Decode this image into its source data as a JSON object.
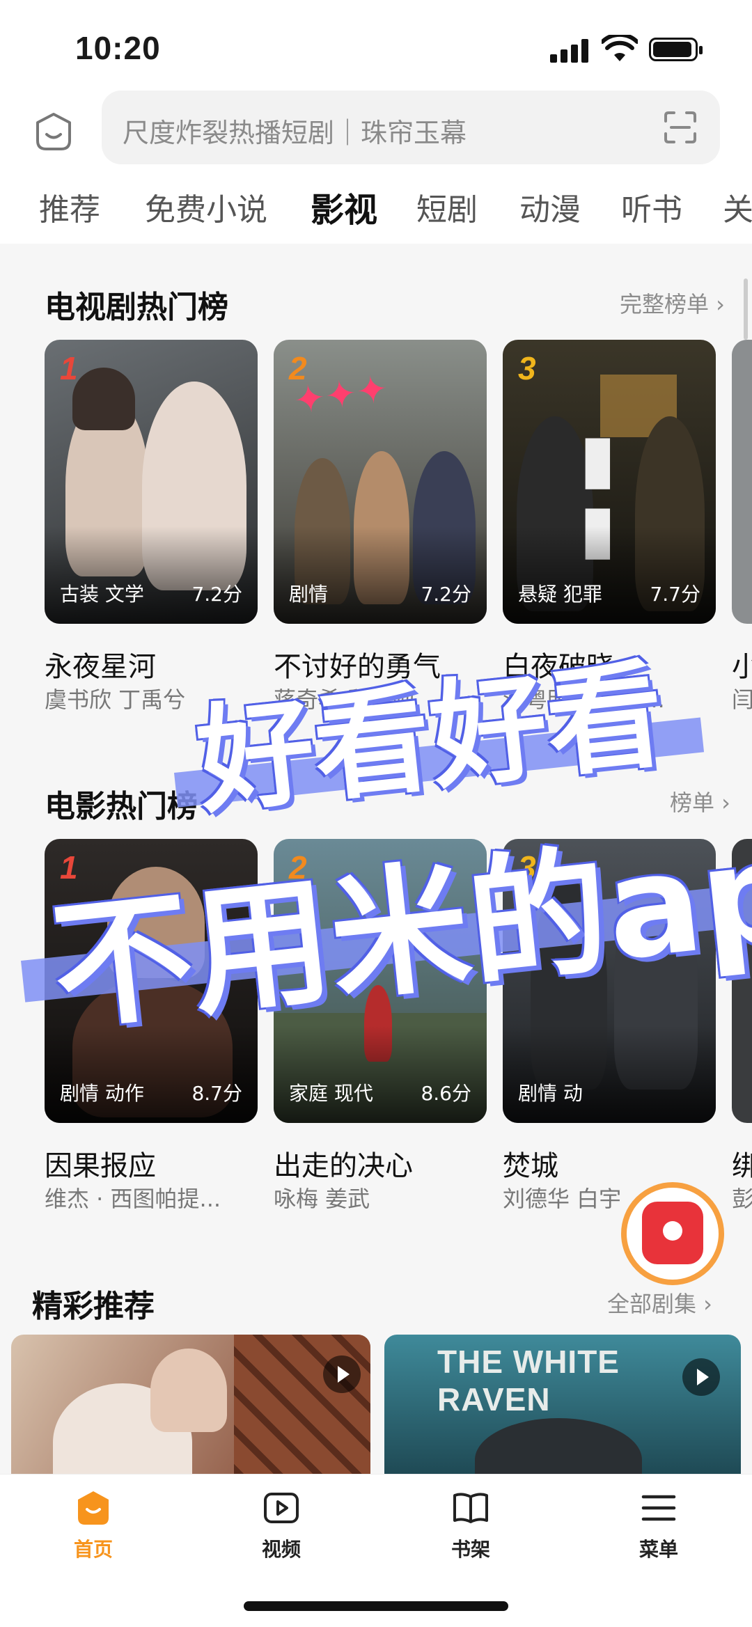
{
  "status": {
    "time": "10:20"
  },
  "search": {
    "placeholder": "尺度炸裂热播短剧｜珠帘玉幕"
  },
  "tabs": [
    "推荐",
    "免费小说",
    "影视",
    "短剧",
    "动漫",
    "听书",
    "关"
  ],
  "active_tab": "影视",
  "tv": {
    "title": "电视剧热门榜",
    "link": "完整榜单 ›",
    "items": [
      {
        "rank": "1",
        "tags": "古装 文学",
        "score": "7.2分",
        "title": "永夜星河",
        "cast": "虞书欣 丁禹兮"
      },
      {
        "rank": "2",
        "tags": "剧情",
        "score": "7.2分",
        "title": "不讨好的勇气",
        "cast": "蒋奇希 魏大勋"
      },
      {
        "rank": "3",
        "tags": "悬疑 犯罪",
        "score": "7.7分",
        "title": "白夜破晓",
        "cast": "潘粤明  王龙正..."
      },
      {
        "rank": "",
        "tags": "",
        "score": "",
        "title": "小",
        "cast": "闫"
      }
    ]
  },
  "movie": {
    "title": "电影热门榜",
    "link": "榜单 ›",
    "items": [
      {
        "rank": "1",
        "tags": "剧情 动作",
        "score": "8.7分",
        "title": "因果报应",
        "cast": "维杰 · 西图帕提..."
      },
      {
        "rank": "2",
        "tags": "家庭 现代",
        "score": "8.6分",
        "title": "出走的决心",
        "cast": "咏梅 姜武"
      },
      {
        "rank": "3",
        "tags": "剧情 动",
        "score": "",
        "title": "焚城",
        "cast": "刘德华 白宇"
      },
      {
        "rank": "",
        "tags": "",
        "score": "",
        "title": "绑",
        "cast": "彭"
      }
    ]
  },
  "featured": {
    "title": "精彩推荐",
    "link": "全部剧集 ›",
    "card2_text": "THE WHITE RAVEN"
  },
  "overlay": {
    "line1": "好看好看",
    "line2": "不用米的app"
  },
  "nav": [
    {
      "label": "首页",
      "icon": "home-icon"
    },
    {
      "label": "视频",
      "icon": "video-icon"
    },
    {
      "label": "书架",
      "icon": "bookshelf-icon"
    },
    {
      "label": "菜单",
      "icon": "menu-icon"
    }
  ],
  "colors": {
    "accent": "#f7941d",
    "overlay": "#6e7cf2",
    "rank1": "#e8473a",
    "rank2": "#f28a1e",
    "rank3": "#f0b51c"
  }
}
